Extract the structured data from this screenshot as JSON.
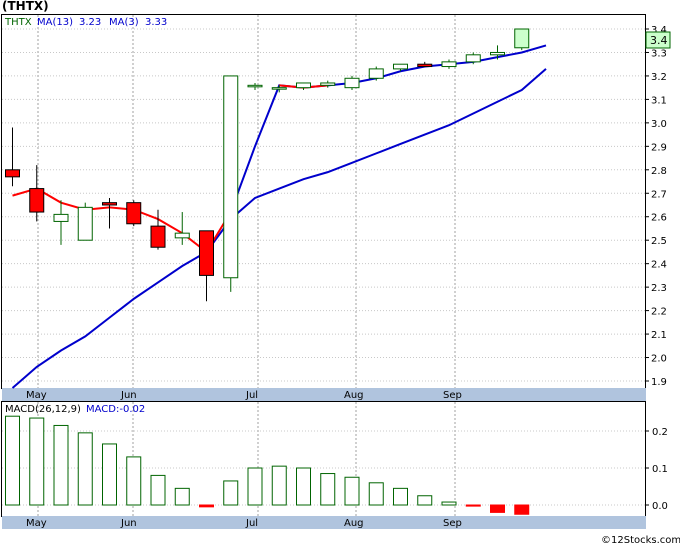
{
  "title": "(THTX)",
  "price_legend": {
    "ticker": "THTX",
    "ma_fast_label": "MA(13)",
    "ma_fast_value": "3.23",
    "ma_slow_label": "MA(3)",
    "ma_slow_value": "3.33"
  },
  "macd_legend": {
    "label": "MACD(26,12,9)",
    "value_label": "MACD:-0.02"
  },
  "last_price_label": "3.4",
  "watermark": "©12Stocks.com",
  "months": [
    "May",
    "Jun",
    "Jul",
    "Aug",
    "Sep"
  ],
  "colors": {
    "up": "#006400",
    "down": "#ff0000",
    "ma_slow": "#0000cc",
    "ma_fast_below": "#ff0000",
    "macd": "#006400",
    "axis_band": "#b0c4de"
  },
  "chart_data": [
    {
      "type": "candlestick",
      "name": "price",
      "y_ticks": [
        "1.9",
        "2.0",
        "2.1",
        "2.2",
        "2.3",
        "2.4",
        "2.5",
        "2.6",
        "2.7",
        "2.8",
        "2.9",
        "3.0",
        "3.1",
        "3.2",
        "3.3",
        "3.4"
      ],
      "ylim": [
        1.87,
        3.45
      ],
      "candles": [
        {
          "i": 0,
          "o": 2.8,
          "h": 2.98,
          "l": 2.73,
          "c": 2.77
        },
        {
          "i": 1,
          "o": 2.72,
          "h": 2.82,
          "l": 2.58,
          "c": 2.62
        },
        {
          "i": 2,
          "o": 2.58,
          "h": 2.67,
          "l": 2.48,
          "c": 2.61
        },
        {
          "i": 3,
          "o": 2.5,
          "h": 2.66,
          "l": 2.5,
          "c": 2.64
        },
        {
          "i": 4,
          "o": 2.66,
          "h": 2.68,
          "l": 2.55,
          "c": 2.65
        },
        {
          "i": 5,
          "o": 2.66,
          "h": 2.67,
          "l": 2.56,
          "c": 2.57
        },
        {
          "i": 6,
          "o": 2.56,
          "h": 2.63,
          "l": 2.46,
          "c": 2.47
        },
        {
          "i": 7,
          "o": 2.51,
          "h": 2.62,
          "l": 2.48,
          "c": 2.53
        },
        {
          "i": 8,
          "o": 2.54,
          "h": 2.54,
          "l": 2.24,
          "c": 2.35
        },
        {
          "i": 9,
          "o": 2.34,
          "h": 3.2,
          "l": 2.28,
          "c": 3.2
        },
        {
          "i": 10,
          "o": 3.16,
          "h": 3.17,
          "l": 3.14,
          "c": 3.16
        },
        {
          "i": 11,
          "o": 3.15,
          "h": 3.16,
          "l": 3.13,
          "c": 3.15
        },
        {
          "i": 12,
          "o": 3.15,
          "h": 3.17,
          "l": 3.14,
          "c": 3.17
        },
        {
          "i": 13,
          "o": 3.16,
          "h": 3.18,
          "l": 3.15,
          "c": 3.17
        },
        {
          "i": 14,
          "o": 3.15,
          "h": 3.2,
          "l": 3.14,
          "c": 3.19
        },
        {
          "i": 15,
          "o": 3.19,
          "h": 3.24,
          "l": 3.18,
          "c": 3.23
        },
        {
          "i": 16,
          "o": 3.23,
          "h": 3.25,
          "l": 3.22,
          "c": 3.25
        },
        {
          "i": 17,
          "o": 3.25,
          "h": 3.26,
          "l": 3.24,
          "c": 3.24
        },
        {
          "i": 18,
          "o": 3.24,
          "h": 3.27,
          "l": 3.23,
          "c": 3.26
        },
        {
          "i": 19,
          "o": 3.26,
          "h": 3.3,
          "l": 3.25,
          "c": 3.29
        },
        {
          "i": 20,
          "o": 3.29,
          "h": 3.33,
          "l": 3.27,
          "c": 3.3
        },
        {
          "i": 21,
          "o": 3.32,
          "h": 3.4,
          "l": 3.31,
          "c": 3.4
        }
      ],
      "ma_slow": [
        1.87,
        1.96,
        2.03,
        2.09,
        2.17,
        2.25,
        2.32,
        2.39,
        2.45,
        2.59,
        2.68,
        2.72,
        2.76,
        2.79,
        2.83,
        2.87,
        2.91,
        2.95,
        2.99,
        3.04,
        3.09,
        3.14,
        3.23
      ],
      "ma_fast": [
        2.69,
        2.72,
        2.66,
        2.63,
        2.64,
        2.63,
        2.59,
        2.53,
        2.45,
        2.62,
        2.9,
        3.16,
        3.15,
        3.16,
        3.17,
        3.19,
        3.22,
        3.24,
        3.25,
        3.26,
        3.28,
        3.3,
        3.33
      ],
      "ma_fast_red_until": 10
    },
    {
      "type": "bar",
      "name": "macd",
      "y_ticks": [
        "0.0",
        "0.1",
        "0.2"
      ],
      "ylim": [
        -0.03,
        0.26
      ],
      "values": [
        0.24,
        0.235,
        0.215,
        0.195,
        0.165,
        0.13,
        0.08,
        0.045,
        -0.005,
        0.065,
        0.1,
        0.105,
        0.1,
        0.085,
        0.075,
        0.06,
        0.045,
        0.025,
        0.008,
        -0.003,
        -0.02,
        -0.025
      ]
    }
  ]
}
